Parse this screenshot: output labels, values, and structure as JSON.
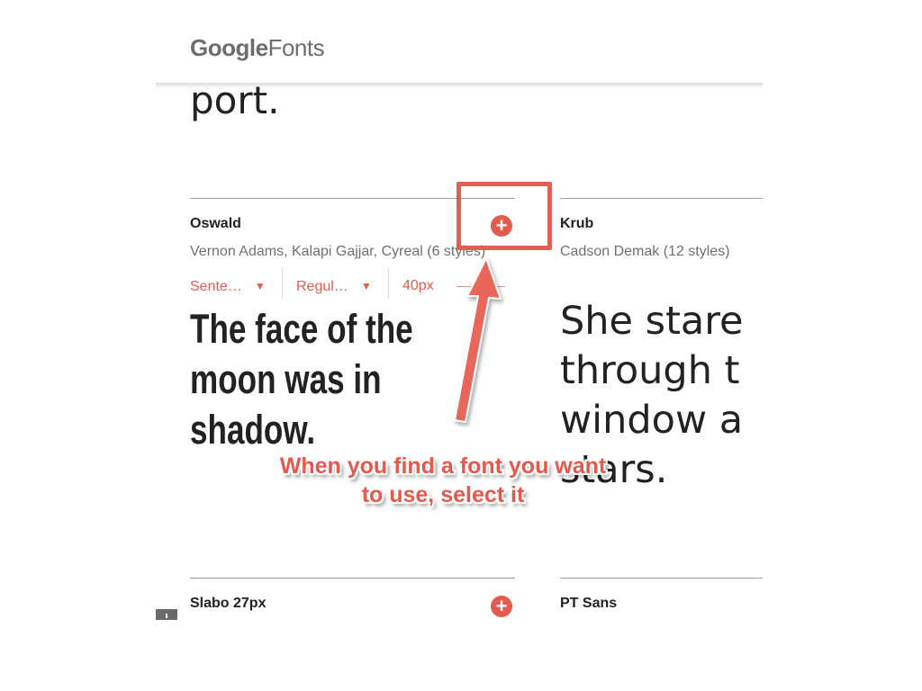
{
  "header": {
    "brand_google": "Google",
    "brand_fonts": "Fonts"
  },
  "previous_card": {
    "sample_text_end": "port."
  },
  "cards": [
    {
      "name": "Oswald",
      "designers": "Vernon Adams, Kalapi Gajjar, Cyreal (6 styles)",
      "sample_lines": [
        "The face of the",
        "moon was in",
        "shadow."
      ]
    },
    {
      "name": "Krub",
      "designers": "Cadson Demak (12 styles)",
      "sample_lines": [
        "She stare",
        "through t",
        "window a",
        "stars."
      ]
    },
    {
      "name": "Slabo 27px"
    },
    {
      "name": "PT Sans"
    }
  ],
  "controls": {
    "sentence": "Sente…",
    "style": "Regul…",
    "size": "40px"
  },
  "icons": {
    "add": "plus-circle-icon",
    "dropdown": "caret-down-icon"
  },
  "annotation": {
    "line1": "When you find a font you want",
    "line2": "to use, select it"
  },
  "colors": {
    "accent": "#e35b4e",
    "annotation": "#e05f52",
    "text": "#202124",
    "secondary_text": "#6f6f6f"
  }
}
